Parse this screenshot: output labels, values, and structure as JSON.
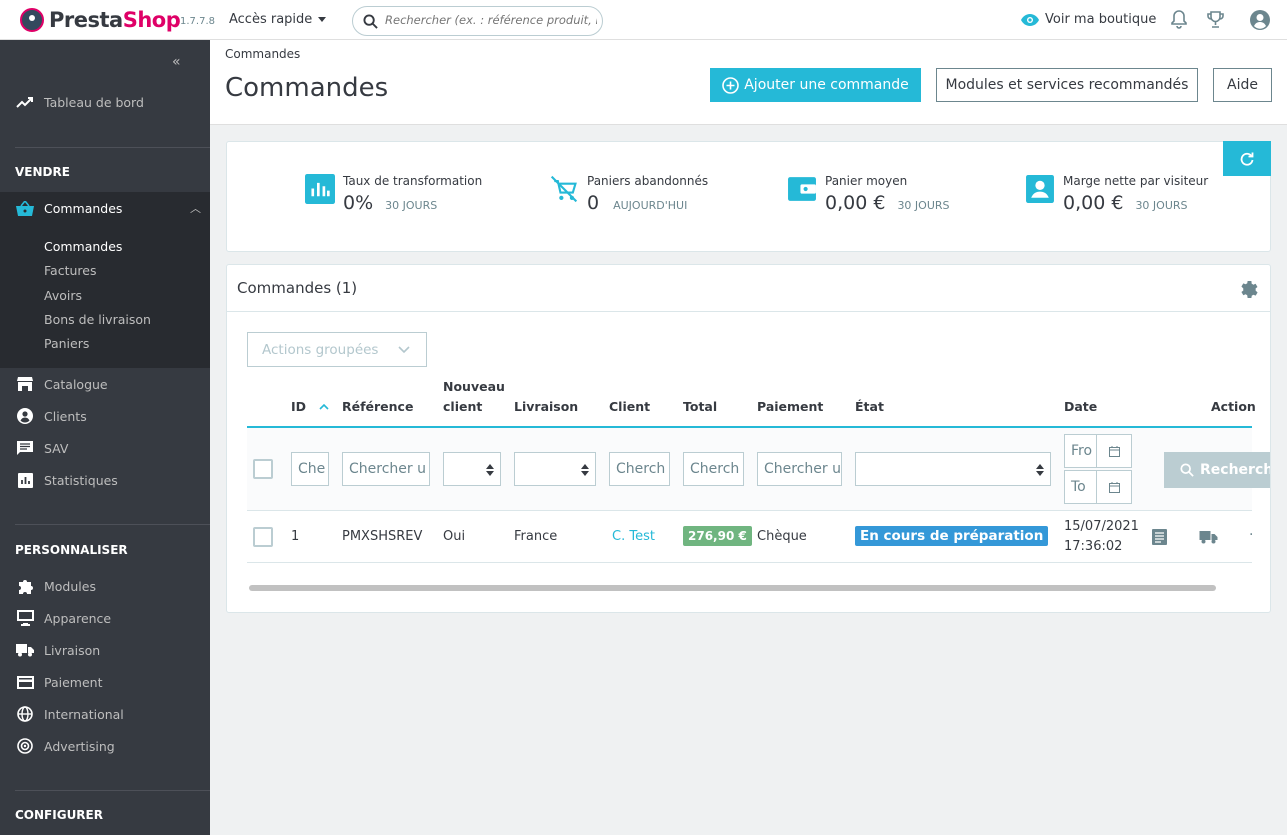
{
  "app": {
    "logo_prefix": "Presta",
    "logo_suffix": "Shop",
    "version": "1.7.7.8",
    "quick_access": "Accès rapide",
    "search_placeholder": "Rechercher (ex. : référence produit, nom",
    "view_shop": "Voir ma boutique"
  },
  "sidebar": {
    "dashboard": "Tableau de bord",
    "sections": {
      "sell": "VENDRE",
      "customize": "PERSONNALISER",
      "configure": "CONFIGURER"
    },
    "orders": "Commandes",
    "orders_sub": [
      "Commandes",
      "Factures",
      "Avoirs",
      "Bons de livraison",
      "Paniers"
    ],
    "sell_items": [
      "Catalogue",
      "Clients",
      "SAV",
      "Statistiques"
    ],
    "customize_items": [
      "Modules",
      "Apparence",
      "Livraison",
      "Paiement",
      "International",
      "Advertising"
    ]
  },
  "header": {
    "breadcrumb": "Commandes",
    "title": "Commandes",
    "add_order": "Ajouter une commande",
    "recommended": "Modules et services recommandés",
    "help": "Aide"
  },
  "kpis": [
    {
      "title": "Taux de transformation",
      "value": "0%",
      "period": "30 JOURS"
    },
    {
      "title": "Paniers abandonnés",
      "value": "0",
      "period": "AUJOURD'HUI"
    },
    {
      "title": "Panier moyen",
      "value": "0,00 €",
      "period": "30 JOURS"
    },
    {
      "title": "Marge nette par visiteur",
      "value": "0,00 €",
      "period": "30 JOURS"
    }
  ],
  "grid": {
    "title": "Commandes (1)",
    "bulk_actions": "Actions groupées",
    "columns": {
      "id": "ID",
      "reference": "Référence",
      "new_client_1": "Nouveau",
      "new_client_2": "client",
      "delivery": "Livraison",
      "client": "Client",
      "total": "Total",
      "payment": "Paiement",
      "state": "État",
      "date": "Date",
      "actions": "Action"
    },
    "filters": {
      "id": "Che",
      "reference": "Chercher u",
      "client": "Cherch",
      "total": "Cherch",
      "payment": "Chercher u",
      "date_from": "Fro",
      "date_to": "To",
      "search_btn": "Recherche"
    },
    "rows": [
      {
        "id": "1",
        "reference": "PMXSHSREV",
        "new_client": "Oui",
        "delivery": "France",
        "client": "C. Test",
        "total": "276,90 €",
        "payment": "Chèque",
        "state": "En cours de préparation",
        "date": "15/07/2021",
        "time": "17:36:02"
      }
    ]
  },
  "colors": {
    "accent": "#25b9d7",
    "sidebar": "#363a41",
    "total_badge": "#70b580",
    "state_badge": "#3498d8"
  }
}
